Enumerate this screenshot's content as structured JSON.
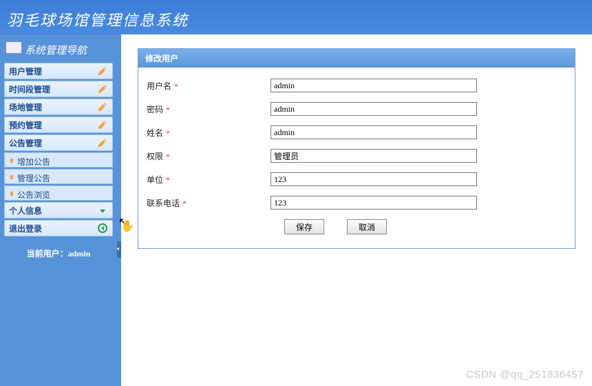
{
  "header": {
    "title": "羽毛球场馆管理信息系统"
  },
  "sidebar": {
    "title": "系统管理导航",
    "items": [
      {
        "label": "用户管理",
        "icon": "edit-icon"
      },
      {
        "label": "时间段管理",
        "icon": "edit-icon"
      },
      {
        "label": "场地管理",
        "icon": "edit-icon"
      },
      {
        "label": "预约管理",
        "icon": "edit-icon"
      },
      {
        "label": "公告管理",
        "icon": "edit-icon"
      }
    ],
    "subitems": [
      {
        "label": "增加公告"
      },
      {
        "label": "管理公告"
      },
      {
        "label": "公告浏览"
      }
    ],
    "footer_items": [
      {
        "label": "个人信息",
        "icon": "arrow-down-icon"
      },
      {
        "label": "退出登录",
        "icon": "exit-icon"
      }
    ],
    "current_user_label": "当前用户：admin"
  },
  "panel": {
    "title": "修改用户",
    "fields": {
      "username": {
        "label": "用户名",
        "value": "admin"
      },
      "password": {
        "label": "密码",
        "value": "admin"
      },
      "realname": {
        "label": "姓名",
        "value": "admin"
      },
      "role": {
        "label": "权限",
        "value": "管理员"
      },
      "unit": {
        "label": "单位",
        "value": "123"
      },
      "phone": {
        "label": "联系电话",
        "value": "123"
      }
    },
    "buttons": {
      "save": "保存",
      "cancel": "取消"
    }
  },
  "watermark": "CSDN @qq_251836457"
}
